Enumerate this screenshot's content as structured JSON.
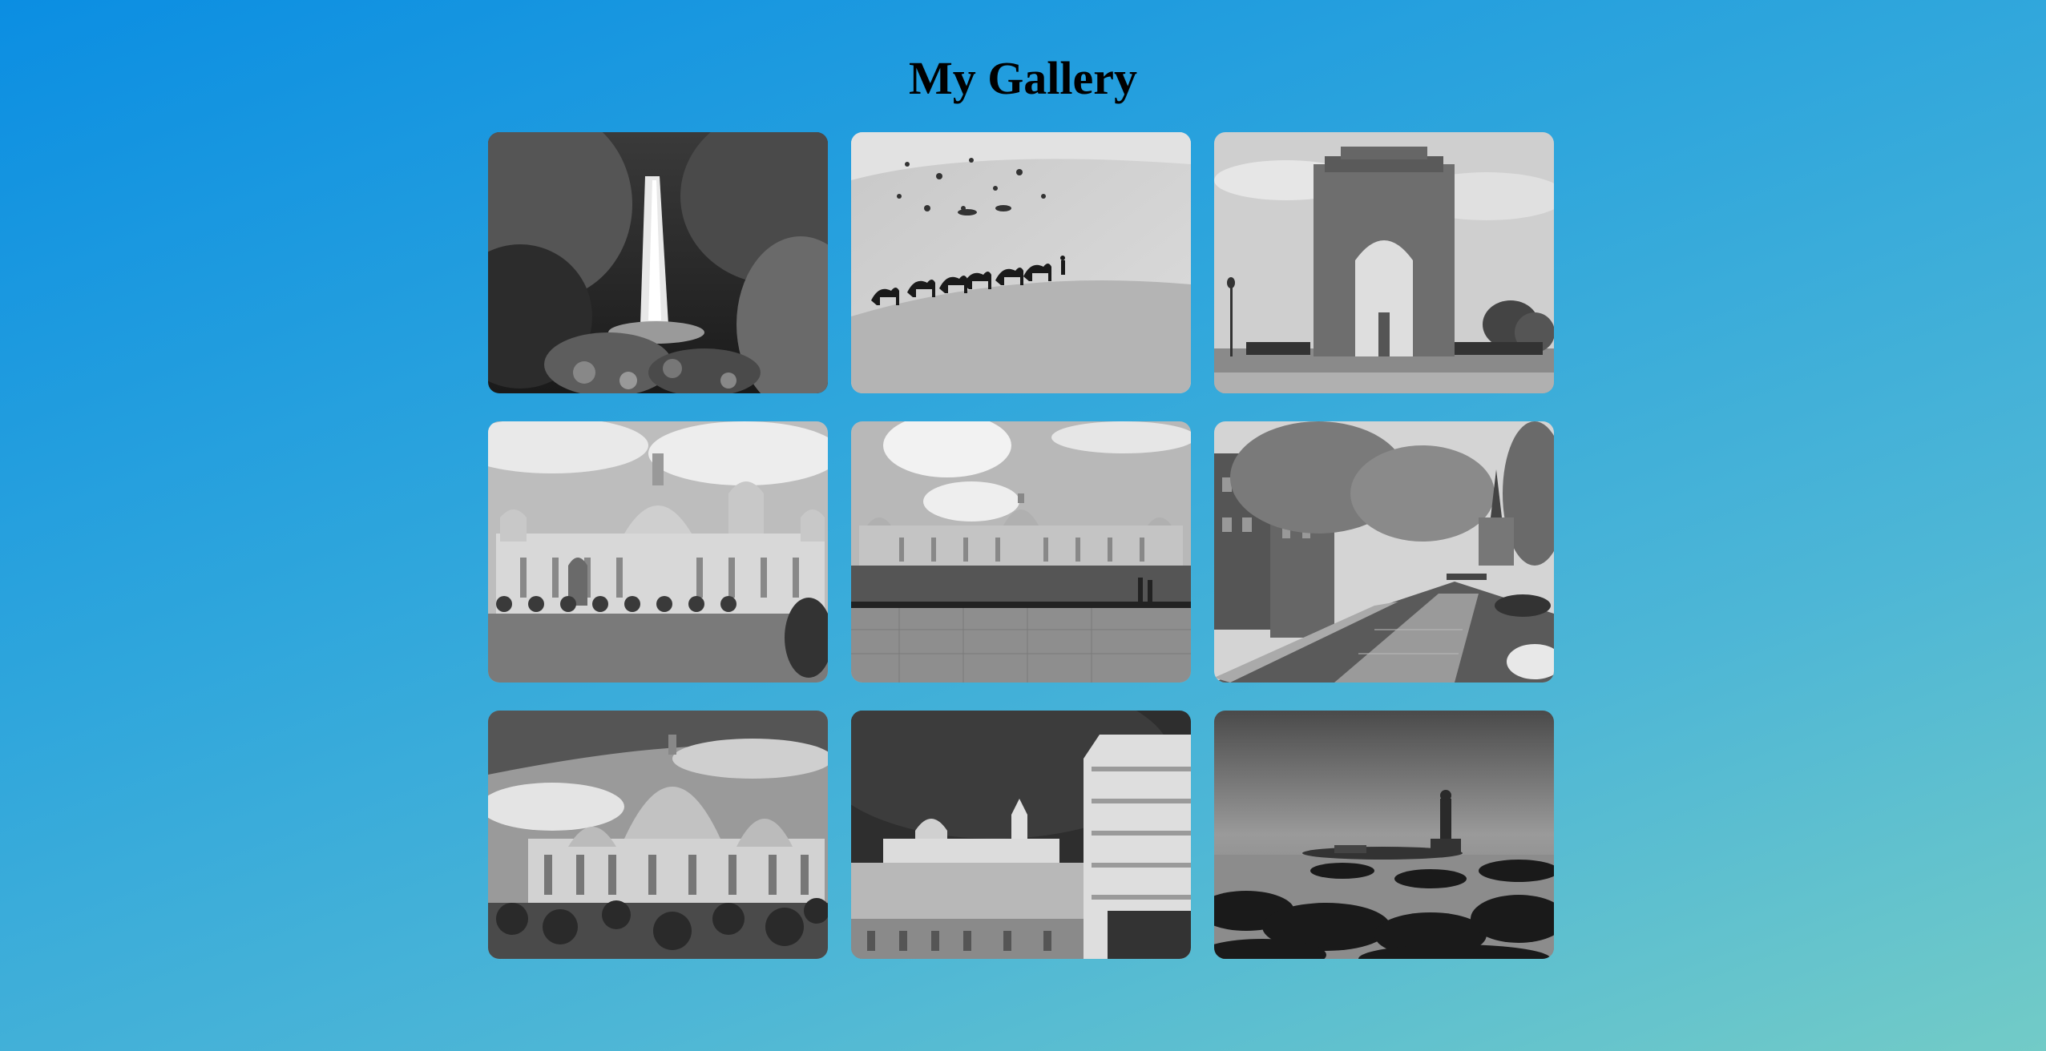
{
  "page": {
    "title": "My Gallery"
  },
  "gallery": {
    "items": [
      {
        "subject": "waterfall"
      },
      {
        "subject": "camel-caravan-desert"
      },
      {
        "subject": "india-gate"
      },
      {
        "subject": "victoria-memorial"
      },
      {
        "subject": "vidhana-soudha"
      },
      {
        "subject": "canal-street"
      },
      {
        "subject": "domed-palace"
      },
      {
        "subject": "temple-gopuram"
      },
      {
        "subject": "seaside-statue"
      }
    ]
  },
  "colors": {
    "background_start": "#0b8ee2",
    "background_end": "#72cbc7",
    "title": "#000000"
  }
}
